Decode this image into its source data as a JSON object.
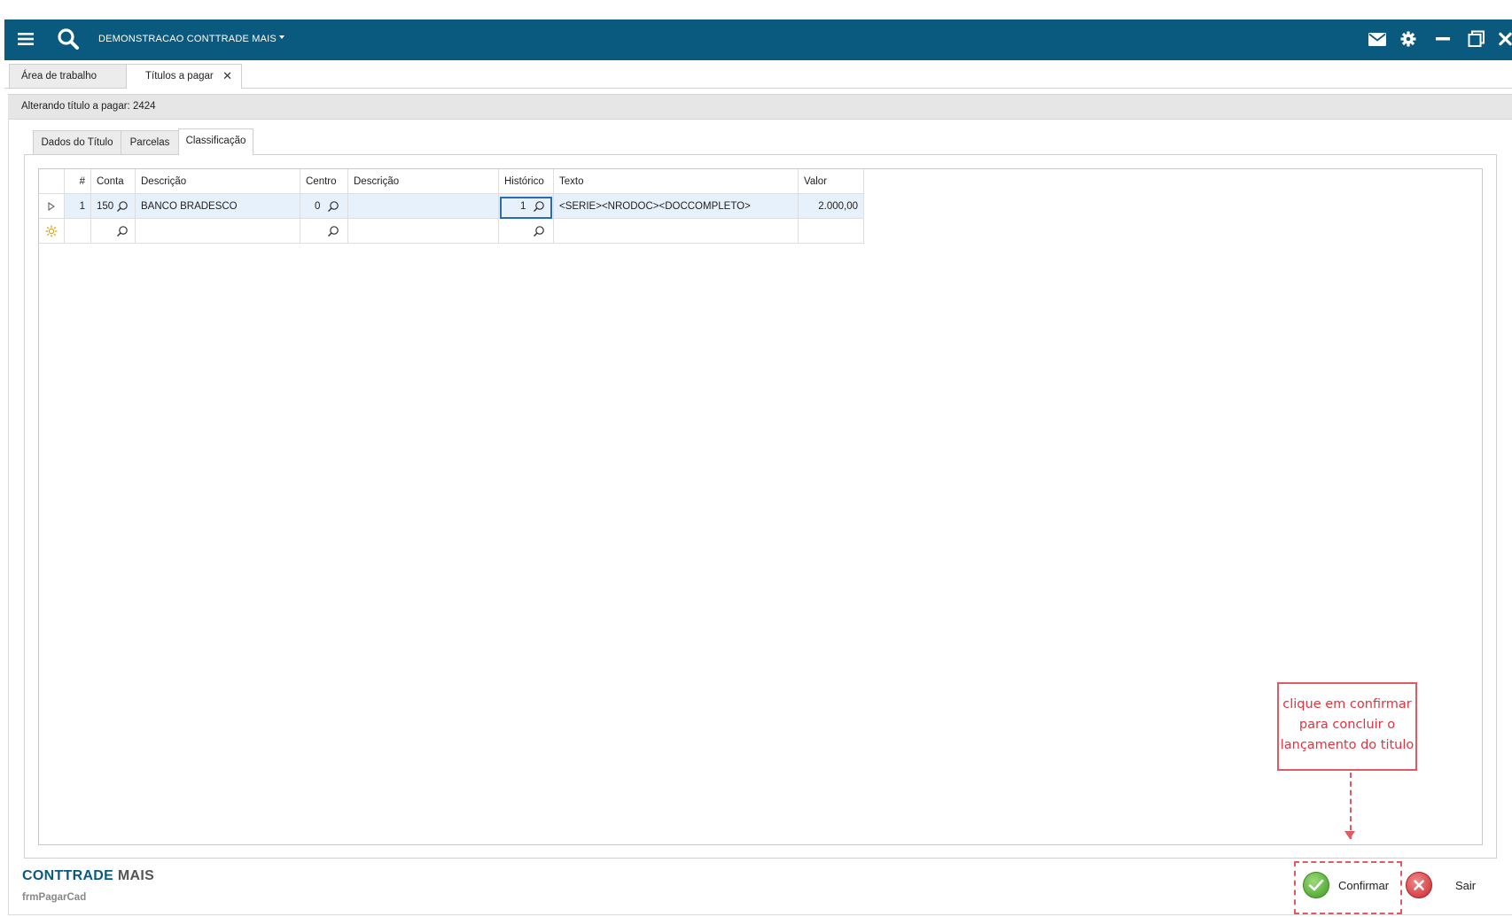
{
  "topbar": {
    "app_title": "DEMONSTRACAO CONTTRADE MAIS",
    "bg_color": "#0a5a80",
    "icons": [
      "menu-icon",
      "search-icon",
      "mail-icon",
      "gear-icon",
      "minimize-icon",
      "restore-icon",
      "close-icon"
    ]
  },
  "outer_tabs": [
    {
      "label": "Área de trabalho"
    },
    {
      "label": "Títulos a pagar"
    }
  ],
  "header": {
    "text": "Alterando título a pagar: 2424"
  },
  "inner_tabs": [
    {
      "label": "Dados do Título"
    },
    {
      "label": "Parcelas"
    },
    {
      "label": "Classificação",
      "active": true
    }
  ],
  "grid": {
    "columns": [
      "#",
      "Conta",
      "Descrição",
      "Centro",
      "Descrição",
      "Histórico",
      "Texto",
      "Valor"
    ],
    "rows": [
      {
        "num": "1",
        "conta": "150",
        "descricao": "BANCO BRADESCO",
        "centro": "0",
        "descricao2": "",
        "historico": "1",
        "texto": "<SERIE><NRODOC><DOCCOMPLETO>",
        "valor": "2.000,00"
      }
    ]
  },
  "callout": {
    "line1": "clique em confirmar",
    "line2": "para concluir o",
    "line3": "lançamento do titulo",
    "color": "#e05a63"
  },
  "footer": {
    "brand_part1": "CONTTRADE",
    "brand_part2": " MAIS",
    "form_name": "frmPagarCad",
    "confirm_label": "Confirmar",
    "exit_label": "Sair"
  }
}
